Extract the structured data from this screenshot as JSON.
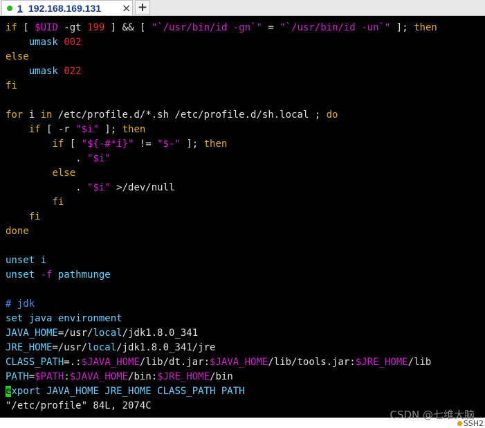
{
  "colors": {
    "keyword": "#e0b020",
    "variable": "#cc22cc",
    "string": "#cc22cc",
    "number": "#dd3333",
    "builtin": "#6bd0ff",
    "comment": "#4b8bff",
    "text": "#e0e0e0",
    "cursor": "#22cc22",
    "session_dot": "#22bb22"
  },
  "tab": {
    "number": "1",
    "title": "192.168.169.131",
    "close_icon": "close-icon"
  },
  "terminal": {
    "lines": [
      [
        [
          "if",
          "keyword"
        ],
        [
          " [ ",
          "text"
        ],
        [
          "$UID",
          "variable"
        ],
        [
          " -gt ",
          "text"
        ],
        [
          "199",
          "number"
        ],
        [
          " ] && [ ",
          "text"
        ],
        [
          "\"`/usr/bin/id -gn`\"",
          "string"
        ],
        [
          " = ",
          "text"
        ],
        [
          "\"`/usr/bin/id -un`\"",
          "string"
        ],
        [
          " ]; ",
          "text"
        ],
        [
          "then",
          "keyword"
        ]
      ],
      [
        [
          "    ",
          "text"
        ],
        [
          "umask",
          "builtin"
        ],
        [
          " ",
          "text"
        ],
        [
          "002",
          "number"
        ]
      ],
      [
        [
          "else",
          "keyword"
        ]
      ],
      [
        [
          "    ",
          "text"
        ],
        [
          "umask",
          "builtin"
        ],
        [
          " ",
          "text"
        ],
        [
          "022",
          "number"
        ]
      ],
      [
        [
          "fi",
          "keyword"
        ]
      ],
      [],
      [
        [
          "for",
          "keyword"
        ],
        [
          " i ",
          "text"
        ],
        [
          "in",
          "keyword"
        ],
        [
          " /etc/profile.d/*.sh /etc/profile.d/sh.local ; ",
          "text"
        ],
        [
          "do",
          "keyword"
        ]
      ],
      [
        [
          "    ",
          "text"
        ],
        [
          "if",
          "keyword"
        ],
        [
          " [ -r ",
          "text"
        ],
        [
          "\"$i\"",
          "string"
        ],
        [
          " ]; ",
          "text"
        ],
        [
          "then",
          "keyword"
        ]
      ],
      [
        [
          "        ",
          "text"
        ],
        [
          "if",
          "keyword"
        ],
        [
          " [ ",
          "text"
        ],
        [
          "\"${-#*i}\"",
          "string"
        ],
        [
          " != ",
          "text"
        ],
        [
          "\"$-\"",
          "string"
        ],
        [
          " ]; ",
          "text"
        ],
        [
          "then",
          "keyword"
        ]
      ],
      [
        [
          "            . ",
          "text"
        ],
        [
          "\"$i\"",
          "string"
        ]
      ],
      [
        [
          "        ",
          "text"
        ],
        [
          "else",
          "keyword"
        ]
      ],
      [
        [
          "            . ",
          "text"
        ],
        [
          "\"$i\"",
          "string"
        ],
        [
          " >/dev/null",
          "text"
        ]
      ],
      [
        [
          "        ",
          "text"
        ],
        [
          "fi",
          "keyword"
        ]
      ],
      [
        [
          "    ",
          "text"
        ],
        [
          "fi",
          "keyword"
        ]
      ],
      [
        [
          "done",
          "keyword"
        ]
      ],
      [],
      [
        [
          "unset",
          "builtin"
        ],
        [
          " i",
          "builtin"
        ]
      ],
      [
        [
          "unset",
          "builtin"
        ],
        [
          " -f ",
          "variable"
        ],
        [
          "pathmunge",
          "builtin"
        ]
      ],
      [],
      [
        [
          "# jdk",
          "comment"
        ]
      ],
      [
        [
          "set java environment",
          "builtin"
        ]
      ],
      [
        [
          "JAVA_HOME",
          "builtin"
        ],
        [
          "=/usr/",
          "text"
        ],
        [
          "local",
          "builtin"
        ],
        [
          "/jdk1.8.0_341",
          "text"
        ]
      ],
      [
        [
          "JRE_HOME",
          "builtin"
        ],
        [
          "=/usr/",
          "text"
        ],
        [
          "local",
          "builtin"
        ],
        [
          "/jdk1.8.0_341/jre",
          "text"
        ]
      ],
      [
        [
          "CLASS_PATH",
          "builtin"
        ],
        [
          "=.:",
          "text"
        ],
        [
          "$JAVA_HOME",
          "variable"
        ],
        [
          "/lib/dt.jar:",
          "text"
        ],
        [
          "$JAVA_HOME",
          "variable"
        ],
        [
          "/lib/tools.jar:",
          "text"
        ],
        [
          "$JRE_HOME",
          "variable"
        ],
        [
          "/lib",
          "text"
        ]
      ],
      [
        [
          "PATH",
          "builtin"
        ],
        [
          "=",
          "text"
        ],
        [
          "$PATH",
          "variable"
        ],
        [
          ":",
          "text"
        ],
        [
          "$JAVA_HOME",
          "variable"
        ],
        [
          "/bin:",
          "text"
        ],
        [
          "$JRE_HOME",
          "variable"
        ],
        [
          "/bin",
          "text"
        ]
      ],
      [
        [
          "e",
          "cursor"
        ],
        [
          "xport JAVA_HOME JRE_HOME CLASS_PATH PATH",
          "builtin"
        ]
      ],
      [
        [
          "\"/etc/profile\" 84L, 2074C",
          "text"
        ]
      ]
    ]
  },
  "watermark": "CSDN @七维大脑",
  "status": {
    "label": "SSH2"
  }
}
